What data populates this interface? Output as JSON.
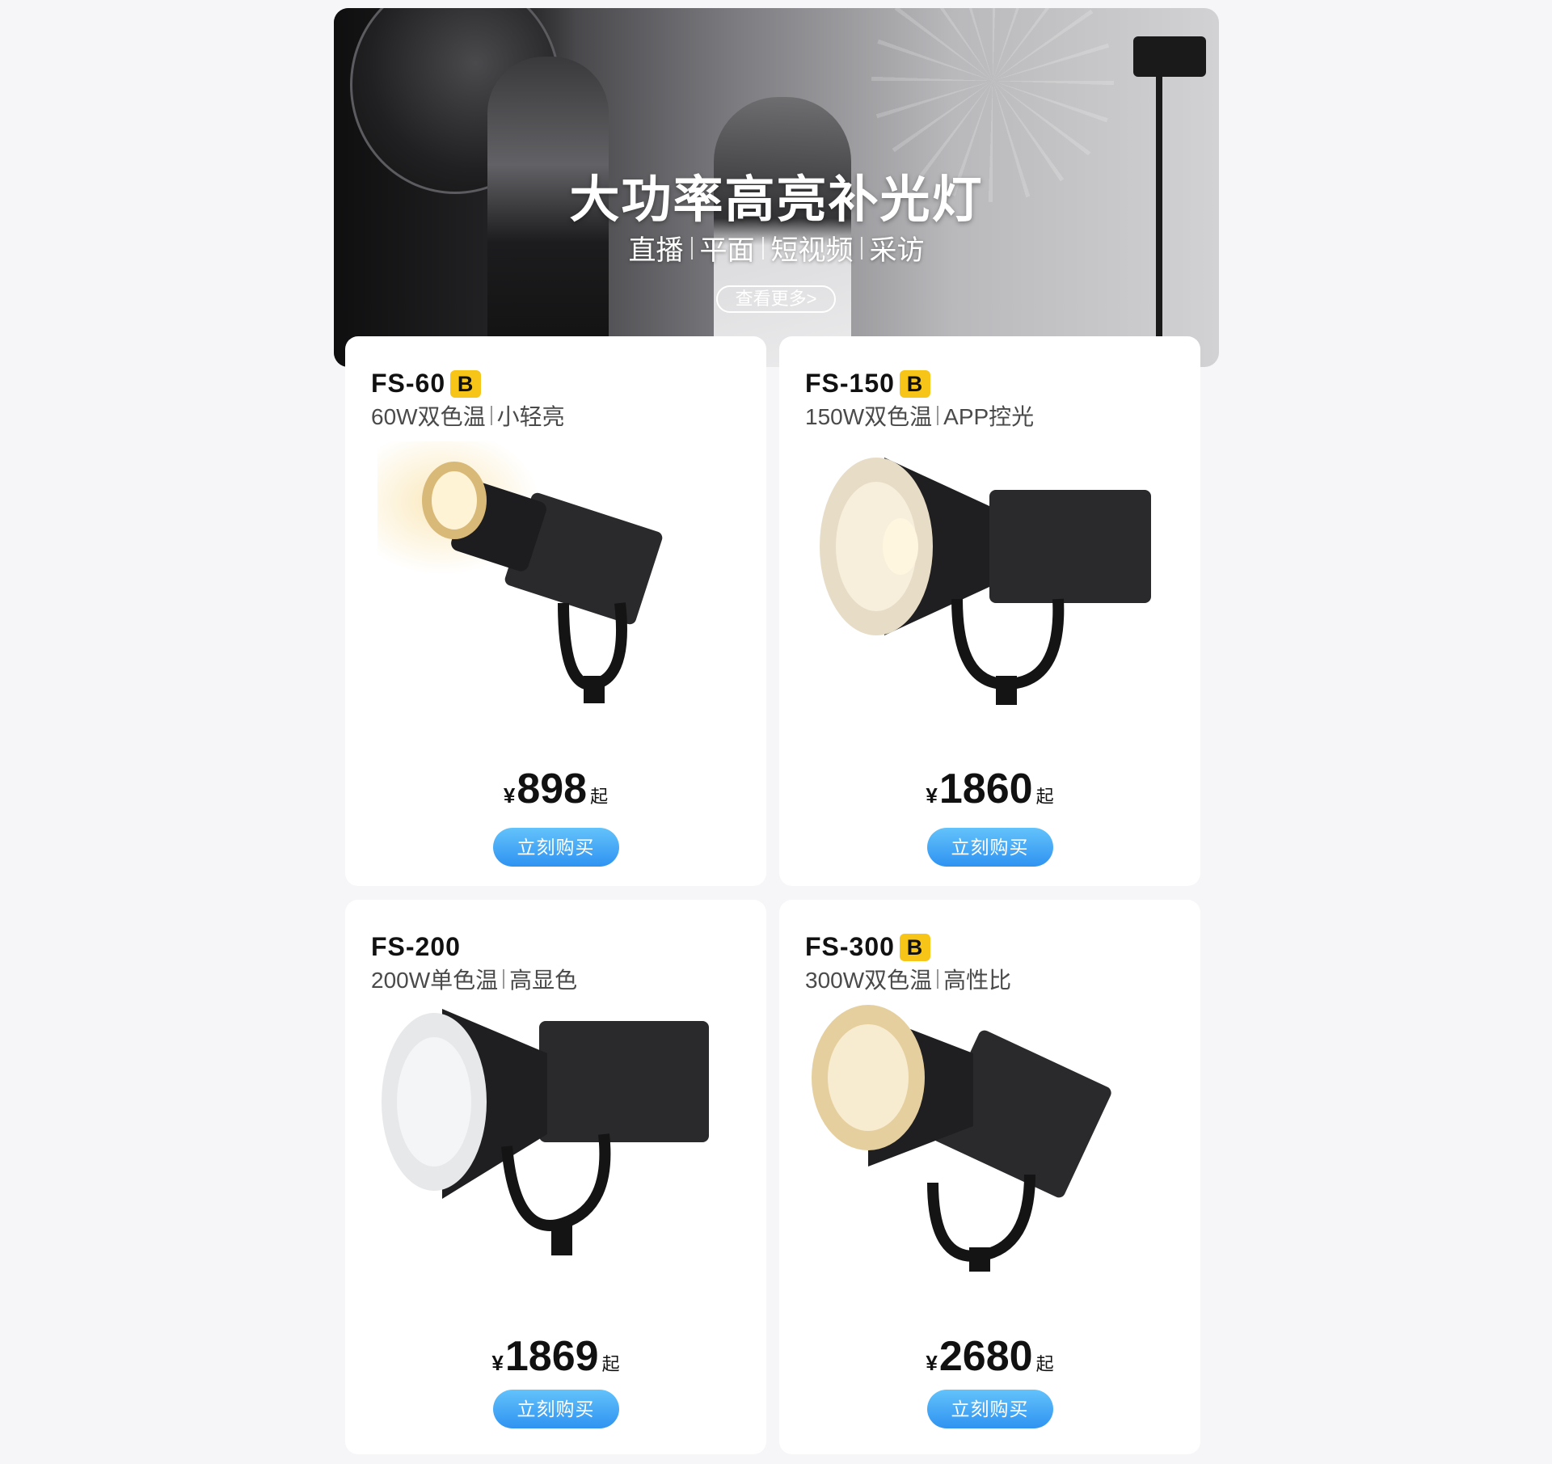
{
  "hero": {
    "title": "大功率高亮补光灯",
    "tags": [
      "直播",
      "平面",
      "短视频",
      "采访"
    ],
    "more_label": "查看更多>"
  },
  "products": [
    {
      "model": "FS-60",
      "badge": "B",
      "spec_main": "60W双色温",
      "spec_sub": "小轻亮",
      "currency": "¥",
      "price": "898",
      "price_suffix": "起",
      "buy_label": "立刻购买",
      "light_color": "#f6dca0"
    },
    {
      "model": "FS-150",
      "badge": "B",
      "spec_main": "150W双色温",
      "spec_sub": "APP控光",
      "currency": "¥",
      "price": "1860",
      "price_suffix": "起",
      "buy_label": "立刻购买",
      "light_color": "#f2e2c2"
    },
    {
      "model": "FS-200",
      "badge": "",
      "spec_main": "200W单色温",
      "spec_sub": "高显色",
      "currency": "¥",
      "price": "1869",
      "price_suffix": "起",
      "buy_label": "立刻购买",
      "light_color": "#eef0f2"
    },
    {
      "model": "FS-300",
      "badge": "B",
      "spec_main": "300W双色温",
      "spec_sub": "高性比",
      "currency": "¥",
      "price": "2680",
      "price_suffix": "起",
      "buy_label": "立刻购买",
      "light_color": "#f3ddb0"
    }
  ],
  "colors": {
    "badge": "#f7c517",
    "buy_button": "#3aa0f5",
    "background": "#f6f6f8"
  }
}
